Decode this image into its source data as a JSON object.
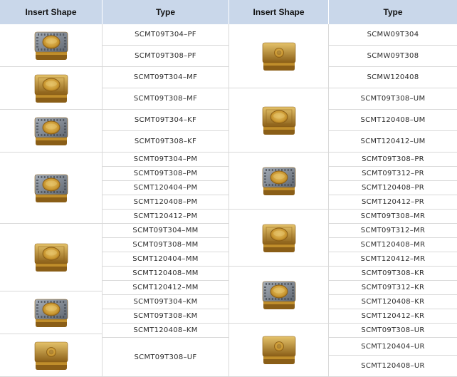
{
  "headers": [
    "Insert Shape",
    "Type",
    "Insert Shape",
    "Type"
  ],
  "colors": {
    "header_bg": "#c9d7ea",
    "gold": "#c9962f",
    "gold_dark": "#8a5e17",
    "gold_light": "#e5c36a",
    "coating_gray": "#5f6670",
    "coating_gray_light": "#a6aeb8"
  },
  "left_types": [
    "SCMT09T304–PF",
    "SCMT09T308–PF",
    "SCMT09T304–MF",
    "SCMT09T308–MF",
    "SCMT09T304–KF",
    "SCMT09T308–KF",
    "SCMT09T304–PM",
    "SCMT09T308–PM",
    "SCMT120404–PM",
    "SCMT120408–PM",
    "SCMT120412–PM",
    "SCMT09T304–MM",
    "SCMT09T308–MM",
    "SCMT120404–MM",
    "SCMT120408–MM",
    "SCMT120412–MM",
    "SCMT09T304–KM",
    "SCMT09T308–KM",
    "SCMT120408–KM",
    "SCMT09T308–UF"
  ],
  "right_types": [
    "SCMW09T304",
    "SCMW09T308",
    "SCMW120408",
    "SCMT09T308–UM",
    "SCMT120408–UM",
    "SCMT120412–UM",
    "SCMT09T308–PR",
    "SCMT09T312–PR",
    "SCMT120408–PR",
    "SCMT120412–PR",
    "SCMT09T308–MR",
    "SCMT09T312–MR",
    "SCMT120408–MR",
    "SCMT120412–MR",
    "SCMT09T308–KR",
    "SCMT09T312–KR",
    "SCMT120408–KR",
    "SCMT120412–KR",
    "SCMT09T308–UR",
    "SCMT120404–UR",
    "SCMT120408–UR"
  ],
  "left_shapes": [
    {
      "icon": "insert-coated-gray-icon",
      "coating": "gray"
    },
    {
      "icon": "insert-gold-icon",
      "coating": "gold"
    },
    {
      "icon": "insert-coated-gray-icon",
      "coating": "gray"
    },
    {
      "icon": "insert-coated-gray-icon",
      "coating": "gray"
    },
    {
      "icon": "insert-gold-icon",
      "coating": "gold"
    },
    {
      "icon": "insert-coated-gray-icon",
      "coating": "gray"
    },
    {
      "icon": "insert-gold-plain-icon",
      "coating": "plain"
    }
  ],
  "right_shapes": [
    {
      "icon": "insert-gold-plain-icon",
      "coating": "plain"
    },
    {
      "icon": "insert-gold-icon",
      "coating": "gold"
    },
    {
      "icon": "insert-coated-gray-icon",
      "coating": "gray"
    },
    {
      "icon": "insert-gold-icon",
      "coating": "gold"
    },
    {
      "icon": "insert-coated-gray-icon",
      "coating": "gray"
    },
    {
      "icon": "insert-gold-plain-icon",
      "coating": "plain"
    }
  ]
}
